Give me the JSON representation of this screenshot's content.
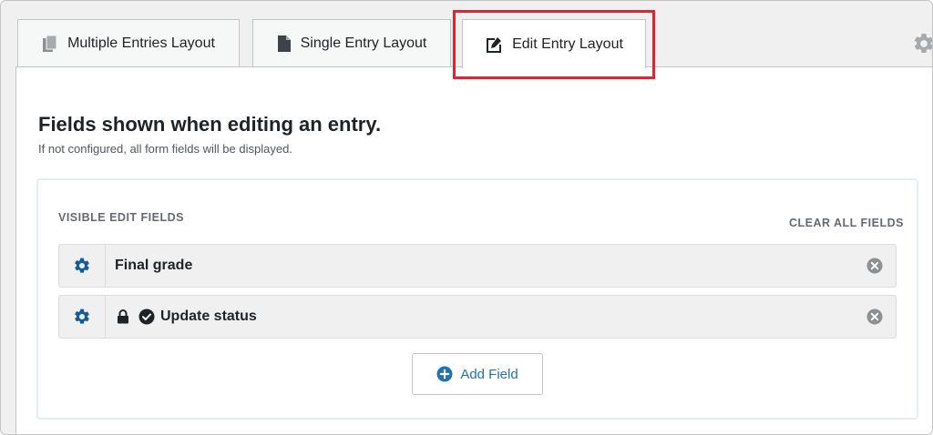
{
  "tabs": [
    {
      "label": "Multiple Entries Layout",
      "icon": "documents-icon",
      "active": false
    },
    {
      "label": "Single Entry Layout",
      "icon": "document-icon",
      "active": false
    },
    {
      "label": "Edit Entry Layout",
      "icon": "edit-document-icon",
      "active": true
    }
  ],
  "settings_icon": "gear-icon",
  "panel": {
    "heading": "Fields shown when editing an entry.",
    "subtext": "If not configured, all form fields will be displayed."
  },
  "box": {
    "label": "VISIBLE EDIT FIELDS",
    "clear_all": "CLEAR ALL FIELDS",
    "fields": [
      {
        "label": "Final grade",
        "locked": false,
        "checked": false
      },
      {
        "label": "Update status",
        "locked": true,
        "checked": true
      }
    ],
    "add_button": "Add Field"
  },
  "colors": {
    "accent_blue": "#2271b1",
    "gear_blue": "#135e96",
    "highlight_red": "#e3232f",
    "icon_gray": "#8c8f94"
  }
}
